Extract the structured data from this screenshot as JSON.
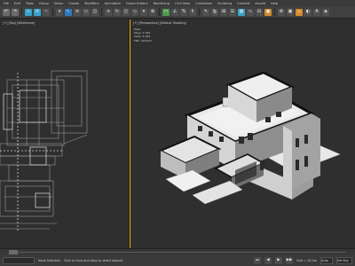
{
  "menu": {
    "items": [
      "File",
      "Edit",
      "Tools",
      "Group",
      "Views",
      "Create",
      "Modifiers",
      "Animation",
      "Graph Editors",
      "Rendering",
      "Civil View",
      "Customize",
      "Scripting",
      "Content",
      "Arnold",
      "Help"
    ]
  },
  "viewports": {
    "left": {
      "label": "[+] [Top] [Wireframe]"
    },
    "right": {
      "label": "[+] [Perspective] [Default Shading]",
      "stats": {
        "total_label": "Total",
        "polys_label": "Polys:",
        "polys_value": "4 162",
        "verts_label": "Verts:",
        "verts_value": "4 250",
        "fps_label": "FPS:",
        "fps_value": "129.872"
      }
    }
  },
  "status": {
    "selection": "None Selected",
    "prompt": "Click or click-and-drag to select objects",
    "grid": "Grid = 10,0m",
    "auto_label": "Auto",
    "setkey_label": "Set Key"
  },
  "colors": {
    "accent": "#f0b400",
    "toolbar_blue": "#2f78c2"
  }
}
